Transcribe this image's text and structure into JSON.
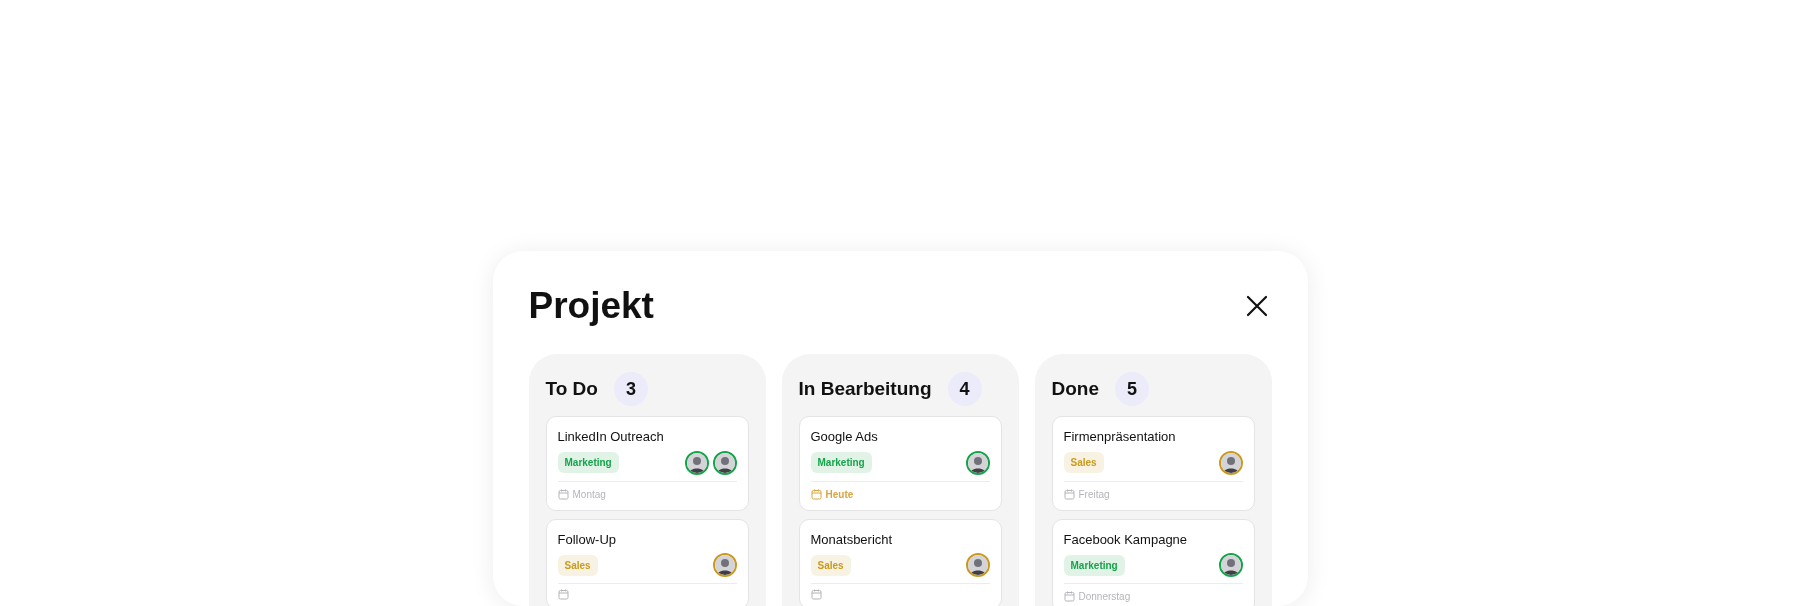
{
  "dialog": {
    "title": "Projekt"
  },
  "columns": [
    {
      "name": "To Do",
      "count": "3",
      "tasks": [
        {
          "title": "LinkedIn Outreach",
          "tag": {
            "label": "Marketing",
            "color": "#16a34a"
          },
          "date": "Montag",
          "due": false
        },
        {
          "title": "Follow-Up",
          "tag": {
            "label": "Sales",
            "color": "#c99a1e"
          }
        }
      ]
    },
    {
      "name": "In Bearbeitung",
      "count": "4",
      "tasks": [
        {
          "title": "Google Ads",
          "tag": {
            "label": "Marketing",
            "color": "#16a34a"
          },
          "date": "Heute",
          "due": true
        },
        {
          "title": "Monatsbericht",
          "tag": {
            "label": "Sales",
            "color": "#c99a1e"
          }
        }
      ]
    },
    {
      "name": "Done",
      "count": "5",
      "tasks": [
        {
          "title": "Firmenpräsentation",
          "tag": {
            "label": "Sales",
            "color": "#c99a1e"
          },
          "date": "Freitag",
          "due": false
        },
        {
          "title": "Facebook Kampagne",
          "tag": {
            "label": "Marketing",
            "color": "#16a34a"
          },
          "date": "Donnerstag",
          "due": false
        }
      ]
    }
  ]
}
